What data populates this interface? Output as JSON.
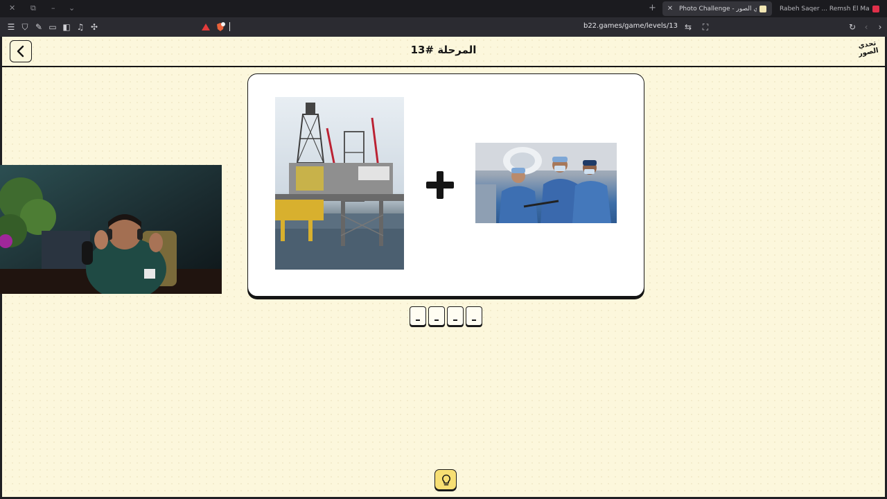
{
  "browser": {
    "tabs": [
      {
        "title": "Photo Challenge - لعبة تحدي الصور",
        "active": true
      },
      {
        "title": "Rabeh Saqer ... Remsh El Maha | المها",
        "active": false
      }
    ],
    "url": "b22.games/game/levels/13"
  },
  "header": {
    "title": "المرحلة #13",
    "logo_text": "تحدي الصور"
  },
  "puzzle": {
    "operator": "+",
    "images": [
      "oil-rig",
      "surgeons"
    ]
  },
  "answer": {
    "slots": [
      "",
      "",
      "",
      ""
    ]
  },
  "colors": {
    "page_bg": "#fcf7dc",
    "card_bg": "#ffffff",
    "outline": "#151515",
    "hint_button": "#f7df73"
  },
  "icons": {
    "back": "chevron-left-icon",
    "hint": "lightbulb-icon",
    "plus": "plus-icon"
  }
}
